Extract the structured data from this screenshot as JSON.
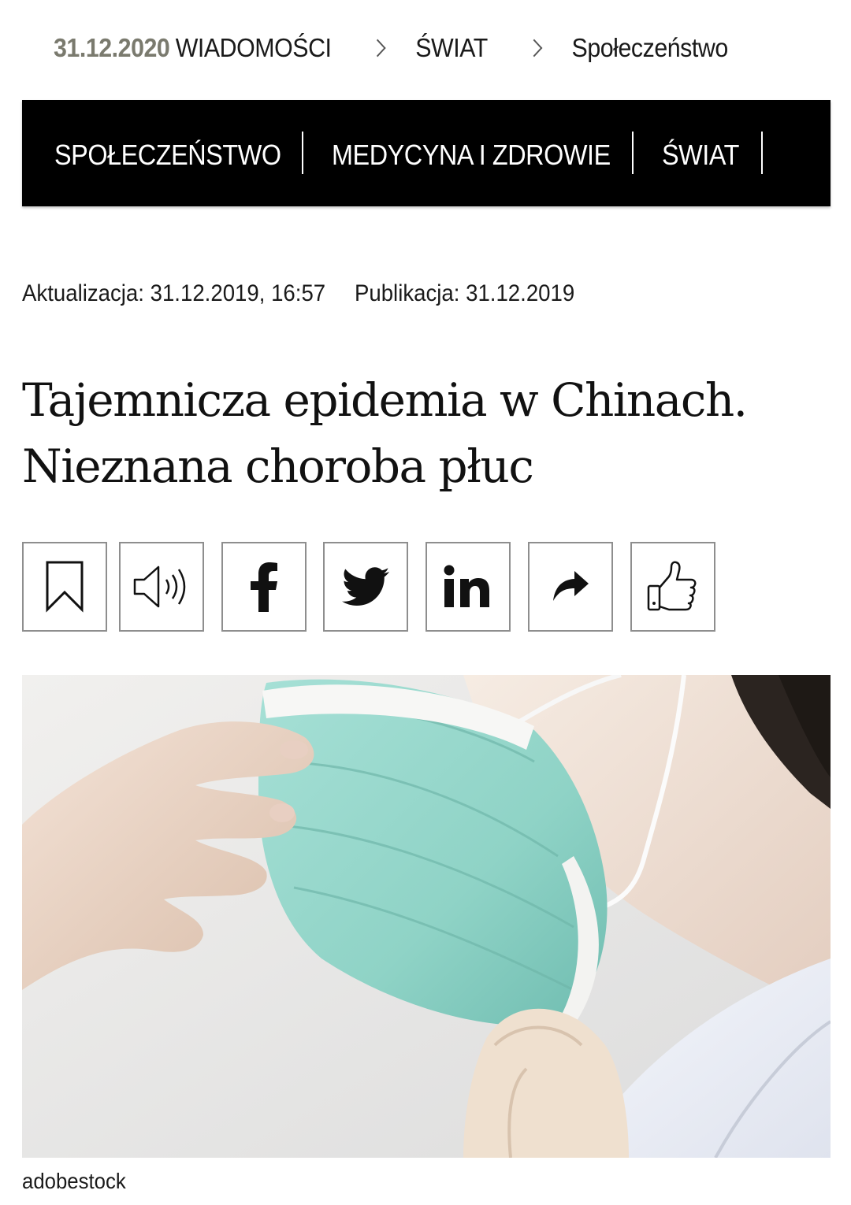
{
  "breadcrumb": {
    "date": "31.12.2020",
    "section": "WIADOMOŚCI",
    "item1": "ŚWIAT",
    "item2": "Społeczeństwo"
  },
  "nav": {
    "tabs": [
      "SPOŁECZEŃSTWO",
      "MEDYCYNA I ZDROWIE",
      "ŚWIAT"
    ]
  },
  "meta": {
    "updated": "Aktualizacja: 31.12.2019, 16:57",
    "published": "Publikacja: 31.12.2019"
  },
  "article": {
    "title_line1": "Tajemnicza epidemia w Chinach.",
    "title_line2": "Nieznana choroba płuc"
  },
  "share": {
    "icons": [
      "bookmark-icon",
      "speaker-icon",
      "facebook-icon",
      "twitter-icon",
      "linkedin-icon",
      "share-arrow-icon",
      "thumbs-up-icon"
    ]
  },
  "image": {
    "caption": "adobestock"
  },
  "colors": {
    "nav_bg": "#000000",
    "date_gray": "#7a7a6e",
    "mask_teal": "#8fd3c6"
  }
}
